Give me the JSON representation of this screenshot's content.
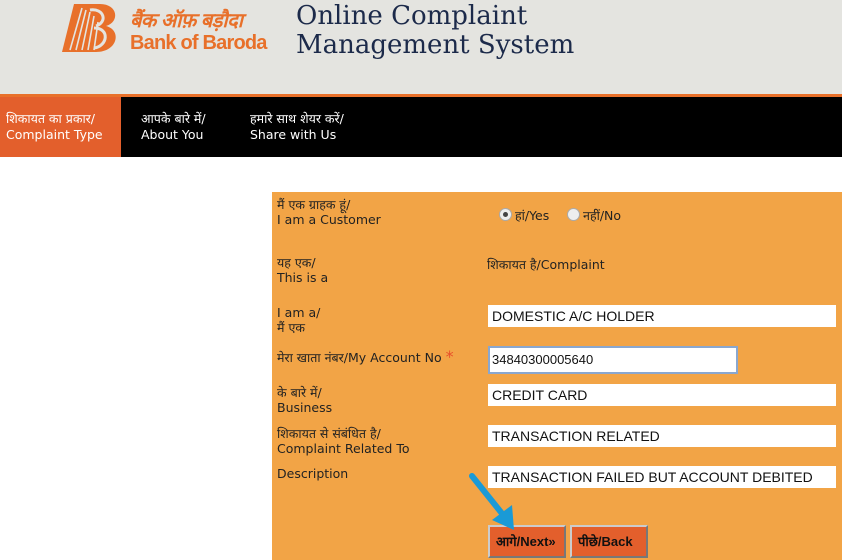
{
  "header": {
    "logo_hindi": "बैंक ऑफ़ बड़ौदा",
    "logo_english": "Bank of Baroda",
    "title_line1": "Online Complaint",
    "title_line2": "Management System",
    "brand_color": "#e8702a"
  },
  "nav": {
    "items": [
      {
        "hindi": "शिकायत का प्रकार/",
        "english": "Complaint Type",
        "active": true
      },
      {
        "hindi": "आपके बारे में/",
        "english": "About You",
        "active": false
      },
      {
        "hindi": "हमारे साथ शेयर करें/",
        "english": "Share with Us",
        "active": false
      }
    ]
  },
  "form": {
    "customer": {
      "label_hindi": "मैं एक ग्राहक हूं/",
      "label_english": "I am a Customer",
      "options": [
        {
          "label": "हां/Yes",
          "selected": true
        },
        {
          "label": "नहीं/No",
          "selected": false
        }
      ]
    },
    "this_is": {
      "label_hindi": "यह एक/",
      "label_english": "This is a",
      "value": "शिकायत है/Complaint"
    },
    "i_am": {
      "label_english": "I am a/",
      "label_hindi": "मैं एक",
      "value": "DOMESTIC A/C HOLDER"
    },
    "account": {
      "label": "मेरा खाता नंबर/My Account No",
      "required_mark": "*",
      "value": "34840300005640"
    },
    "business": {
      "label_hindi": "के बारे में/",
      "label_english": "Business",
      "value": "CREDIT CARD"
    },
    "related": {
      "label_hindi": "शिकायत से संबंधित है/",
      "label_english": "Complaint Related To",
      "value": "TRANSACTION RELATED"
    },
    "description": {
      "label": "Description",
      "value": "TRANSACTION FAILED BUT ACCOUNT DEBITED"
    },
    "buttons": {
      "next": "आगे/Next»",
      "back": "पीछे/Back"
    }
  },
  "annotation": {
    "arrow_color": "#1a9ad6",
    "points_to": "next-button"
  }
}
